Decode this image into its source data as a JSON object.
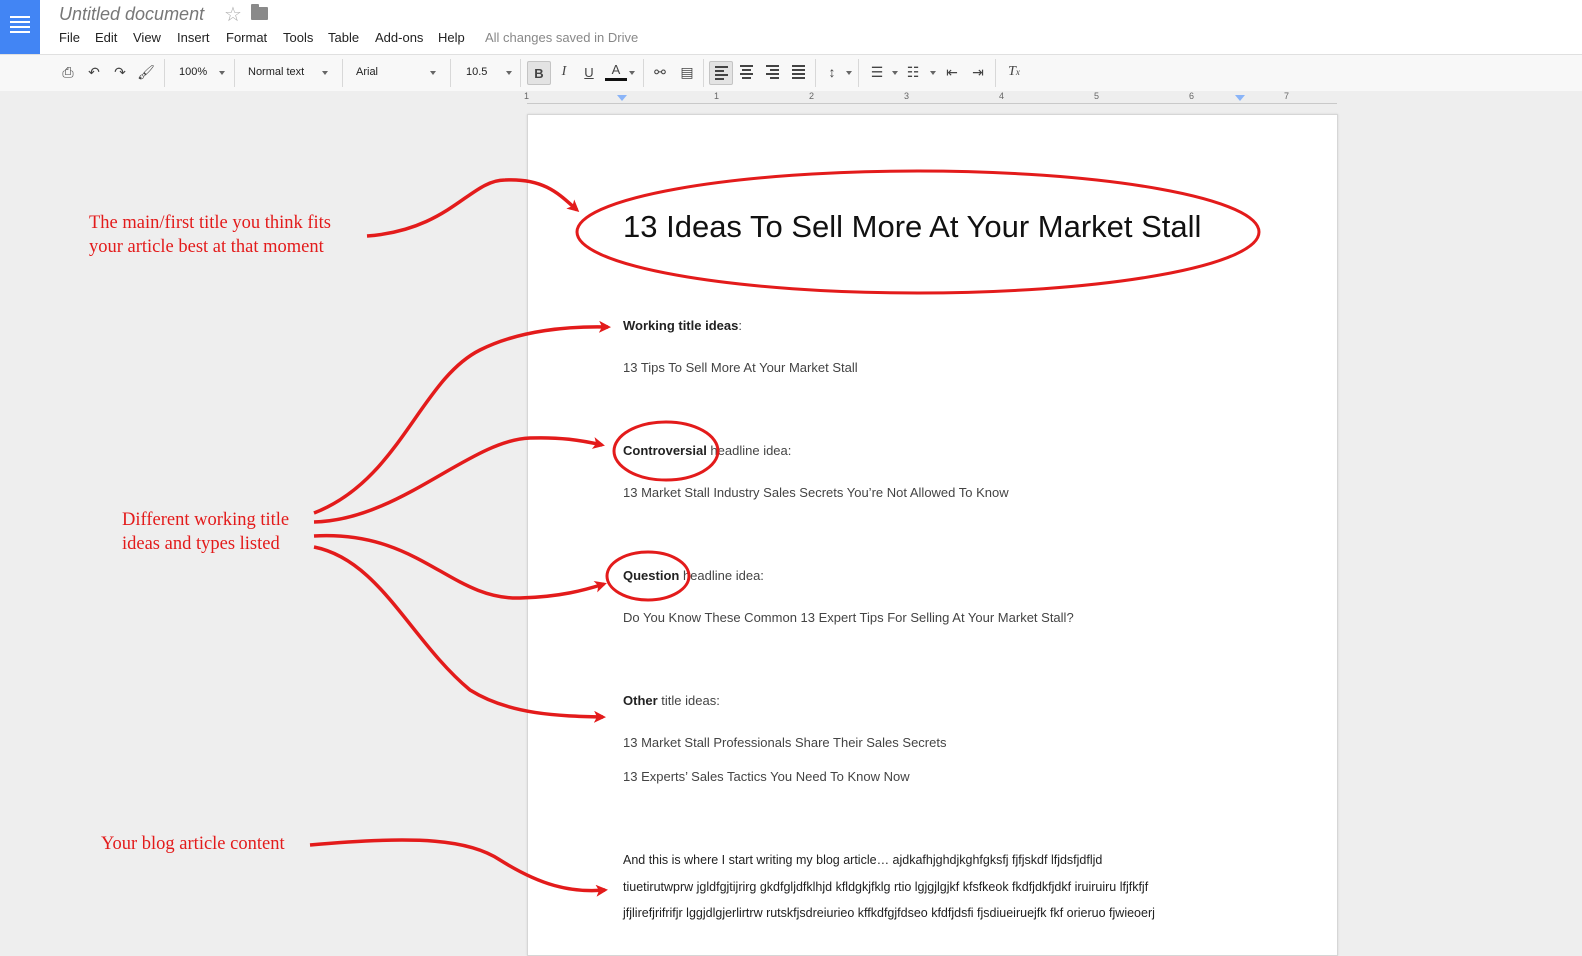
{
  "app": {
    "doc_title": "Untitled document",
    "save_status": "All changes saved in Drive"
  },
  "menu": [
    "File",
    "Edit",
    "View",
    "Insert",
    "Format",
    "Tools",
    "Table",
    "Add-ons",
    "Help"
  ],
  "toolbar": {
    "zoom": "100%",
    "style": "Normal text",
    "font": "Arial",
    "font_size": "10.5",
    "bold_label": "B",
    "italic_label": "I",
    "underline_label": "U",
    "text_color_label": "A",
    "icons": [
      "print-icon",
      "undo-icon",
      "redo-icon",
      "paint-format-icon",
      "link-icon",
      "comment-icon",
      "align-left-icon",
      "align-center-icon",
      "align-right-icon",
      "justify-icon",
      "line-spacing-icon",
      "numbered-list-icon",
      "bulleted-list-icon",
      "decrease-indent-icon",
      "increase-indent-icon",
      "clear-formatting-icon"
    ]
  },
  "ruler": [
    "1",
    "1",
    "2",
    "3",
    "4",
    "5",
    "6",
    "7"
  ],
  "document": {
    "main_title": "13 Ideas To Sell More At Your Market Stall",
    "working_label": "Working title ideas",
    "working_suffix": ":",
    "working_1": "13 Tips To Sell More At Your Market Stall",
    "controversial_label": "Controversial",
    "controversial_suffix": " headline idea:",
    "controversial_1": "13 Market Stall Industry Sales Secrets You’re Not Allowed To Know",
    "question_label": "Question",
    "question_suffix": " headline idea:",
    "question_1": "Do You Know These Common 13 Expert Tips For Selling At Your Market Stall?",
    "other_label": "Other",
    "other_suffix": " title ideas:",
    "other_1": "13 Market Stall Professionals Share Their Sales Secrets",
    "other_2": "13 Experts’ Sales Tactics You Need To Know Now",
    "body_1": "And this is where I start writing my blog article… ajdkafhjghdjkghfgksfj fjfjskdf lfjdsfjdfljd",
    "body_2": "tiuetirutwprw jgldfgjtijrirg gkdfgljdfklhjd kfldgkjfklg rtio lgjgjlgjkf kfsfkeok fkdfjdkfjdkf iruiruiru lfjfkfjf",
    "body_3": "jfjlirefjrifrifjr lggjdlgjerlirtrw rutskfjsdreiurieo kffkdfgjfdseo kfdfjdsfi fjsdiueiruejfk fkf orieruo fjwieoerj"
  },
  "annotations": {
    "title_note_1": "The main/first title you think fits",
    "title_note_2": "your article best at that moment",
    "ideas_note_1": "Different working title",
    "ideas_note_2": "ideas and types listed",
    "content_note": "Your blog article content"
  },
  "colors": {
    "accent": "#4285f4",
    "annotation_red": "#e31b1b"
  }
}
